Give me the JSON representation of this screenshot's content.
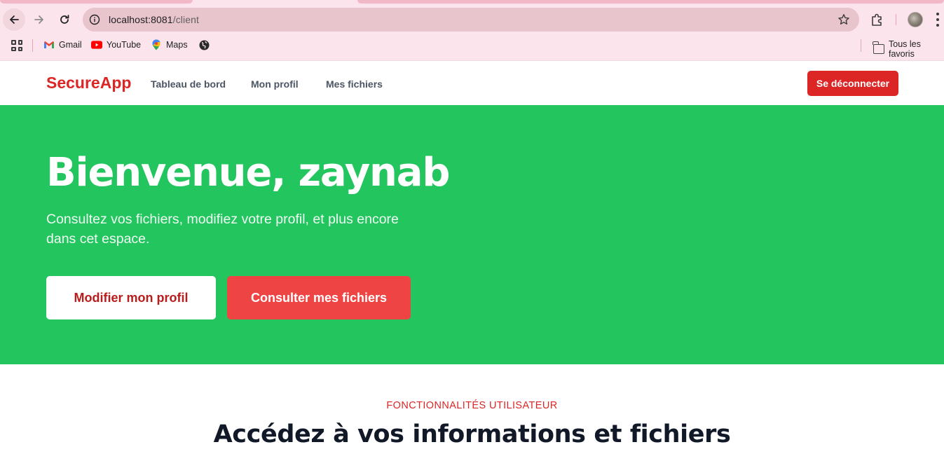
{
  "browser": {
    "url_host": "localhost:8081",
    "url_path": "/client",
    "bookmarks": [
      {
        "label": "Gmail",
        "icon": "gmail-icon"
      },
      {
        "label": "YouTube",
        "icon": "youtube-icon"
      },
      {
        "label": "Maps",
        "icon": "maps-icon"
      },
      {
        "label": "",
        "icon": "globe-icon"
      }
    ],
    "all_bookmarks_label": "Tous les favoris"
  },
  "navbar": {
    "brand": "SecureApp",
    "links": [
      "Tableau de bord",
      "Mon profil",
      "Mes fichiers"
    ],
    "logout_label": "Se déconnecter"
  },
  "hero": {
    "title": "Bienvenue, zaynab",
    "subtitle": "Consultez vos fichiers, modifiez votre profil, et plus encore dans cet espace.",
    "primary_button": "Modifier mon profil",
    "secondary_button": "Consulter mes fichiers"
  },
  "features": {
    "eyebrow": "FONCTIONNALITÉS UTILISATEUR",
    "title": "Accédez à vos informations et fichiers"
  },
  "colors": {
    "brand_red": "#dc2626",
    "hero_green": "#22c55e",
    "button_red": "#ef4444",
    "chrome_pink": "#fce4ec"
  }
}
